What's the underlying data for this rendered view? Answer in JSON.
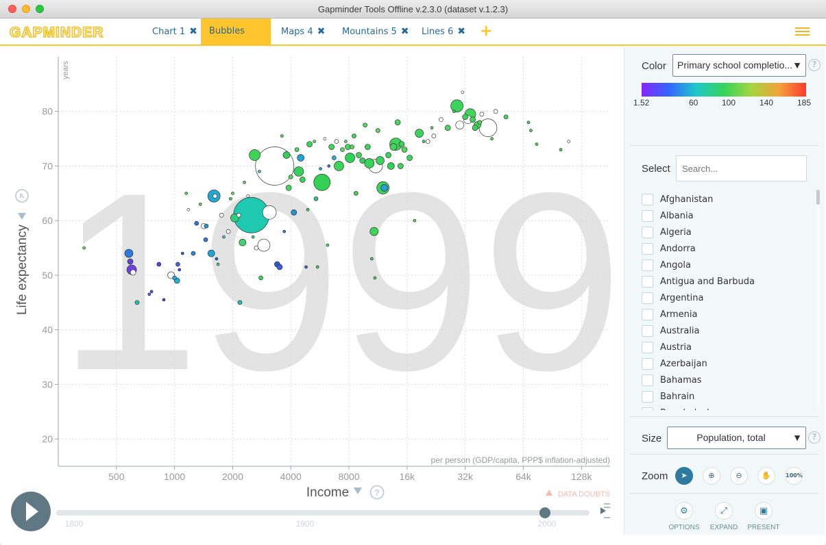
{
  "window": {
    "title": "Gapminder Tools Offline v.2.3.0 (dataset v.1.2.3)"
  },
  "header": {
    "logo": "GAPMINDER",
    "tabs": [
      {
        "label": "Chart 1",
        "active": false
      },
      {
        "label": "Bubbles 2",
        "active": true
      },
      {
        "label": "Maps 4",
        "active": false
      },
      {
        "label": "Mountains 5",
        "active": false
      },
      {
        "label": "Lines 6",
        "active": false
      }
    ],
    "add_tab": "+"
  },
  "chart": {
    "year": "1999",
    "y_title": "Life expectancy",
    "y_unit": "years",
    "x_title": "Income",
    "x_unit": "per person (GDP/capita, PPP$ inflation-adjusted)",
    "data_doubts": "DATA DOUBTS",
    "help": "?",
    "timeline_labels": [
      "1800",
      "1900",
      "2000"
    ]
  },
  "chart_data": {
    "type": "scatter",
    "x_scale": "log",
    "xlabel": "Income",
    "ylabel": "Life expectancy",
    "x_ticks": [
      "500",
      "1000",
      "2000",
      "4000",
      "8000",
      "16k",
      "32k",
      "64k",
      "128k"
    ],
    "y_ticks": [
      "20",
      "30",
      "40",
      "50",
      "60",
      "70",
      "80"
    ],
    "xlim": [
      250,
      180000
    ],
    "ylim": [
      15,
      90
    ],
    "points": [
      {
        "x": 340,
        "y": 55,
        "r": 2,
        "c": "#5dd75e"
      },
      {
        "x": 580,
        "y": 54,
        "r": 6,
        "c": "#2f7bdb"
      },
      {
        "x": 590,
        "y": 52.5,
        "r": 4,
        "c": "#5947d9"
      },
      {
        "x": 600,
        "y": 51,
        "r": 7,
        "c": "#6a43dd"
      },
      {
        "x": 610,
        "y": 50.5,
        "r": 4,
        "c": "#ffffff"
      },
      {
        "x": 640,
        "y": 45,
        "r": 3,
        "c": "#1fc9a6"
      },
      {
        "x": 740,
        "y": 46.5,
        "r": 2,
        "c": "#4a6adf"
      },
      {
        "x": 760,
        "y": 47,
        "r": 2,
        "c": "#3f52db"
      },
      {
        "x": 830,
        "y": 52,
        "r": 3,
        "c": "#4b4bdc"
      },
      {
        "x": 880,
        "y": 45.5,
        "r": 2,
        "c": "#5b2fe0"
      },
      {
        "x": 960,
        "y": 50,
        "r": 5,
        "c": "#ffffff"
      },
      {
        "x": 1000,
        "y": 49.5,
        "r": 3,
        "c": "#2aa3d6"
      },
      {
        "x": 1030,
        "y": 49,
        "r": 4,
        "c": "#20b6c8"
      },
      {
        "x": 1040,
        "y": 52,
        "r": 3,
        "c": "#3d68dd"
      },
      {
        "x": 1060,
        "y": 51,
        "r": 2,
        "c": "#3b49dd"
      },
      {
        "x": 1100,
        "y": 54,
        "r": 2,
        "c": "#2c5bd8"
      },
      {
        "x": 1150,
        "y": 65,
        "r": 2,
        "c": "#5dd75e"
      },
      {
        "x": 1180,
        "y": 62,
        "r": 2,
        "c": "#ffffff"
      },
      {
        "x": 1250,
        "y": 54,
        "r": 3,
        "c": "#2a86d8"
      },
      {
        "x": 1300,
        "y": 59.5,
        "r": 3,
        "c": "#2874d8"
      },
      {
        "x": 1360,
        "y": 63,
        "r": 2,
        "c": "#6dd860"
      },
      {
        "x": 1420,
        "y": 59,
        "r": 4,
        "c": "#ffffff"
      },
      {
        "x": 1450,
        "y": 56.5,
        "r": 3,
        "c": "#3579d9"
      },
      {
        "x": 1460,
        "y": 59,
        "r": 3,
        "c": "#2097d6"
      },
      {
        "x": 1550,
        "y": 54,
        "r": 5,
        "c": "#21a5d5"
      },
      {
        "x": 1600,
        "y": 64.5,
        "r": 9,
        "c": "#20a9d3"
      },
      {
        "x": 1620,
        "y": 64.5,
        "r": 3,
        "c": "#ffffff"
      },
      {
        "x": 1650,
        "y": 53,
        "r": 2,
        "c": "#2a60d7"
      },
      {
        "x": 1680,
        "y": 52,
        "r": 2,
        "c": "#3bd08a"
      },
      {
        "x": 1750,
        "y": 61,
        "r": 3,
        "c": "#ffffff"
      },
      {
        "x": 1800,
        "y": 57,
        "r": 2,
        "c": "#42c0c2"
      },
      {
        "x": 1900,
        "y": 58,
        "r": 3,
        "c": "#ffffff"
      },
      {
        "x": 1950,
        "y": 64,
        "r": 2,
        "c": "#3fd25c"
      },
      {
        "x": 2000,
        "y": 65,
        "r": 2,
        "c": "#62d15d"
      },
      {
        "x": 2050,
        "y": 60.5,
        "r": 6,
        "c": "#2cd079"
      },
      {
        "x": 2150,
        "y": 61,
        "r": 3,
        "c": "#ffffff"
      },
      {
        "x": 2180,
        "y": 45,
        "r": 3,
        "c": "#26c0b1"
      },
      {
        "x": 2250,
        "y": 56,
        "r": 5,
        "c": "#3fd76c"
      },
      {
        "x": 2300,
        "y": 67,
        "r": 2,
        "c": "#4cd562"
      },
      {
        "x": 2400,
        "y": 64.5,
        "r": 2,
        "c": "#ffffff"
      },
      {
        "x": 2500,
        "y": 61,
        "r": 26,
        "c": "#1fc9b0"
      },
      {
        "x": 2550,
        "y": 57,
        "r": 2,
        "c": "#4bd66b"
      },
      {
        "x": 2600,
        "y": 72,
        "r": 8,
        "c": "#3fd258"
      },
      {
        "x": 2650,
        "y": 55,
        "r": 3,
        "c": "#ffffff"
      },
      {
        "x": 2750,
        "y": 69,
        "r": 2,
        "c": "#2ec8c0"
      },
      {
        "x": 2800,
        "y": 49.5,
        "r": 3,
        "c": "#3ad35d"
      },
      {
        "x": 2900,
        "y": 55.5,
        "r": 9,
        "c": "#ffffff"
      },
      {
        "x": 3100,
        "y": 61.5,
        "r": 10,
        "c": "#ffffff"
      },
      {
        "x": 3300,
        "y": 70,
        "r": 28,
        "c": "#ffffff"
      },
      {
        "x": 3400,
        "y": 52,
        "r": 4,
        "c": "#2b5bd8"
      },
      {
        "x": 3500,
        "y": 51.5,
        "r": 4,
        "c": "#3f5ddb"
      },
      {
        "x": 3600,
        "y": 75.5,
        "r": 2,
        "c": "#54d85a"
      },
      {
        "x": 3700,
        "y": 58,
        "r": 2,
        "c": "#2f7ede"
      },
      {
        "x": 3800,
        "y": 72,
        "r": 5,
        "c": "#37cc5c"
      },
      {
        "x": 3900,
        "y": 66,
        "r": 4,
        "c": "#46d660"
      },
      {
        "x": 4000,
        "y": 68,
        "r": 3,
        "c": "#52d85e"
      },
      {
        "x": 4150,
        "y": 61.5,
        "r": 4,
        "c": "#2592d4"
      },
      {
        "x": 4300,
        "y": 73,
        "r": 3,
        "c": "#4dd55f"
      },
      {
        "x": 4400,
        "y": 69,
        "r": 7,
        "c": "#36d15b"
      },
      {
        "x": 4500,
        "y": 71.5,
        "r": 5,
        "c": "#25a3d3"
      },
      {
        "x": 4600,
        "y": 67.5,
        "r": 4,
        "c": "#3ad35b"
      },
      {
        "x": 4800,
        "y": 51.5,
        "r": 2,
        "c": "#2d6ad7"
      },
      {
        "x": 4900,
        "y": 62,
        "r": 2,
        "c": "#3fce62"
      },
      {
        "x": 5000,
        "y": 74,
        "r": 4,
        "c": "#3bd45b"
      },
      {
        "x": 5300,
        "y": 74.5,
        "r": 2,
        "c": "#5bd85c"
      },
      {
        "x": 5400,
        "y": 64,
        "r": 3,
        "c": "#2ec78a"
      },
      {
        "x": 5500,
        "y": 51.5,
        "r": 2,
        "c": "#39d25b"
      },
      {
        "x": 5700,
        "y": 69.5,
        "r": 2,
        "c": "#2e9bd3"
      },
      {
        "x": 5800,
        "y": 67,
        "r": 12,
        "c": "#34d055"
      },
      {
        "x": 6000,
        "y": 75,
        "r": 2,
        "c": "#ffffff"
      },
      {
        "x": 6200,
        "y": 55.5,
        "r": 2,
        "c": "#47d262"
      },
      {
        "x": 6300,
        "y": 70,
        "r": 2,
        "c": "#2c7cd7"
      },
      {
        "x": 6500,
        "y": 73.5,
        "r": 4,
        "c": "#40d45c"
      },
      {
        "x": 6700,
        "y": 71.5,
        "r": 3,
        "c": "#2daed2"
      },
      {
        "x": 6900,
        "y": 74.5,
        "r": 3,
        "c": "#ffffff"
      },
      {
        "x": 7100,
        "y": 70,
        "r": 7,
        "c": "#3dd35a"
      },
      {
        "x": 7400,
        "y": 73,
        "r": 3,
        "c": "#5dd85c"
      },
      {
        "x": 7700,
        "y": 74.5,
        "r": 2,
        "c": "#55d75f"
      },
      {
        "x": 7900,
        "y": 73.5,
        "r": 4,
        "c": "#47d65f"
      },
      {
        "x": 8100,
        "y": 71.5,
        "r": 7,
        "c": "#2fd258"
      },
      {
        "x": 8300,
        "y": 73.5,
        "r": 3,
        "c": "#5ad85c"
      },
      {
        "x": 8500,
        "y": 75.5,
        "r": 3,
        "c": "#44d45e"
      },
      {
        "x": 8700,
        "y": 65,
        "r": 3,
        "c": "#3cd35c"
      },
      {
        "x": 9000,
        "y": 72,
        "r": 4,
        "c": "#43d35a"
      },
      {
        "x": 9400,
        "y": 71,
        "r": 4,
        "c": "#35d15b"
      },
      {
        "x": 9700,
        "y": 77.5,
        "r": 3,
        "c": "#54d85d"
      },
      {
        "x": 10000,
        "y": 73.5,
        "r": 4,
        "c": "#3fd35a"
      },
      {
        "x": 10200,
        "y": 70.5,
        "r": 7,
        "c": "#37d25a"
      },
      {
        "x": 10500,
        "y": 53,
        "r": 2,
        "c": "#3acb5d"
      },
      {
        "x": 10800,
        "y": 58,
        "r": 6,
        "c": "#3dd45a"
      },
      {
        "x": 10900,
        "y": 49.5,
        "r": 2,
        "c": "#3dd45a"
      },
      {
        "x": 11000,
        "y": 70,
        "r": 10,
        "c": "#ffffff"
      },
      {
        "x": 11300,
        "y": 76.5,
        "r": 3,
        "c": "#5ed95b"
      },
      {
        "x": 11600,
        "y": 71,
        "r": 6,
        "c": "#3bd35b"
      },
      {
        "x": 12000,
        "y": 66,
        "r": 9,
        "c": "#3dd15d"
      },
      {
        "x": 12200,
        "y": 66,
        "r": 5,
        "c": "#2a9ed6"
      },
      {
        "x": 12800,
        "y": 72,
        "r": 4,
        "c": "#39d25a"
      },
      {
        "x": 13200,
        "y": 70,
        "r": 5,
        "c": "#32d15a"
      },
      {
        "x": 13600,
        "y": 73.5,
        "r": 5,
        "c": "#48d45c"
      },
      {
        "x": 14000,
        "y": 74,
        "r": 9,
        "c": "#3bd35a"
      },
      {
        "x": 14300,
        "y": 78,
        "r": 4,
        "c": "#4ed55c"
      },
      {
        "x": 14800,
        "y": 70,
        "r": 4,
        "c": "#41d45b"
      },
      {
        "x": 15000,
        "y": 74,
        "r": 4,
        "c": "#38d15b"
      },
      {
        "x": 15500,
        "y": 73,
        "r": 4,
        "c": "#4fd65c"
      },
      {
        "x": 16500,
        "y": 71.5,
        "r": 4,
        "c": "#3fd45b"
      },
      {
        "x": 17500,
        "y": 60,
        "r": 2,
        "c": "#4dd55f"
      },
      {
        "x": 18500,
        "y": 76,
        "r": 6,
        "c": "#3ed35a"
      },
      {
        "x": 19500,
        "y": 74.5,
        "r": 2,
        "c": "#3cd35b"
      },
      {
        "x": 20500,
        "y": 74.5,
        "r": 3,
        "c": "#ffffff"
      },
      {
        "x": 21500,
        "y": 77,
        "r": 2,
        "c": "#5bd85c"
      },
      {
        "x": 22000,
        "y": 75.5,
        "r": 3,
        "c": "#ffffff"
      },
      {
        "x": 24000,
        "y": 78.5,
        "r": 3,
        "c": "#ffffff"
      },
      {
        "x": 26000,
        "y": 77,
        "r": 4,
        "c": "#4dd65c"
      },
      {
        "x": 28000,
        "y": 80,
        "r": 2,
        "c": "#40d45b"
      },
      {
        "x": 29000,
        "y": 81,
        "r": 9,
        "c": "#3bd35a"
      },
      {
        "x": 30000,
        "y": 77.5,
        "r": 6,
        "c": "#ffffff"
      },
      {
        "x": 31000,
        "y": 83.5,
        "r": 2,
        "c": "#ffffff"
      },
      {
        "x": 32000,
        "y": 79,
        "r": 4,
        "c": "#3bd35a"
      },
      {
        "x": 33000,
        "y": 78.5,
        "r": 6,
        "c": "#ffffff"
      },
      {
        "x": 34000,
        "y": 79.5,
        "r": 8,
        "c": "#44d45c"
      },
      {
        "x": 35000,
        "y": 78.5,
        "r": 4,
        "c": "#3fd35a"
      },
      {
        "x": 36000,
        "y": 77,
        "r": 4,
        "c": "#3dd35a"
      },
      {
        "x": 37000,
        "y": 77.5,
        "r": 5,
        "c": "#42d35b"
      },
      {
        "x": 38000,
        "y": 78,
        "r": 3,
        "c": "#4ed55d"
      },
      {
        "x": 39000,
        "y": 79.5,
        "r": 3,
        "c": "#ffffff"
      },
      {
        "x": 42000,
        "y": 77,
        "r": 13,
        "c": "#ffffff"
      },
      {
        "x": 44000,
        "y": 75,
        "r": 2,
        "c": "#53d75c"
      },
      {
        "x": 46000,
        "y": 80,
        "r": 3,
        "c": "#ffffff"
      },
      {
        "x": 52000,
        "y": 79,
        "r": 3,
        "c": "#46d45c"
      },
      {
        "x": 68000,
        "y": 78,
        "r": 2,
        "c": "#3fd45b"
      },
      {
        "x": 70000,
        "y": 76.5,
        "r": 2,
        "c": "#41d35a"
      },
      {
        "x": 75000,
        "y": 74,
        "r": 2,
        "c": "#3fd45b"
      },
      {
        "x": 100000,
        "y": 73,
        "r": 2,
        "c": "#3ed35a"
      },
      {
        "x": 110000,
        "y": 74.5,
        "r": 2,
        "c": "#ffffff"
      }
    ]
  },
  "sidebar": {
    "color_label": "Color",
    "color_value": "Primary school completio...",
    "legend_ticks": [
      "1.52",
      "60",
      "100",
      "140",
      "185"
    ],
    "legend_colors": [
      "#8426ff",
      "#3366ff",
      "#1ec8c8",
      "#35d35a",
      "#a3d63f",
      "#f2a33a",
      "#ff3a2d"
    ],
    "select_label": "Select",
    "search_placeholder": "Search...",
    "countries": [
      "Afghanistan",
      "Albania",
      "Algeria",
      "Andorra",
      "Angola",
      "Antigua and Barbuda",
      "Argentina",
      "Armenia",
      "Australia",
      "Austria",
      "Azerbaijan",
      "Bahamas",
      "Bahrain",
      "Bangladesh"
    ],
    "size_label": "Size",
    "size_value": "Population, total",
    "zoom_label": "Zoom",
    "zoom_100": "100%",
    "buttons": {
      "options": "OPTIONS",
      "expand": "EXPAND",
      "present": "PRESENT"
    },
    "help": "?"
  }
}
